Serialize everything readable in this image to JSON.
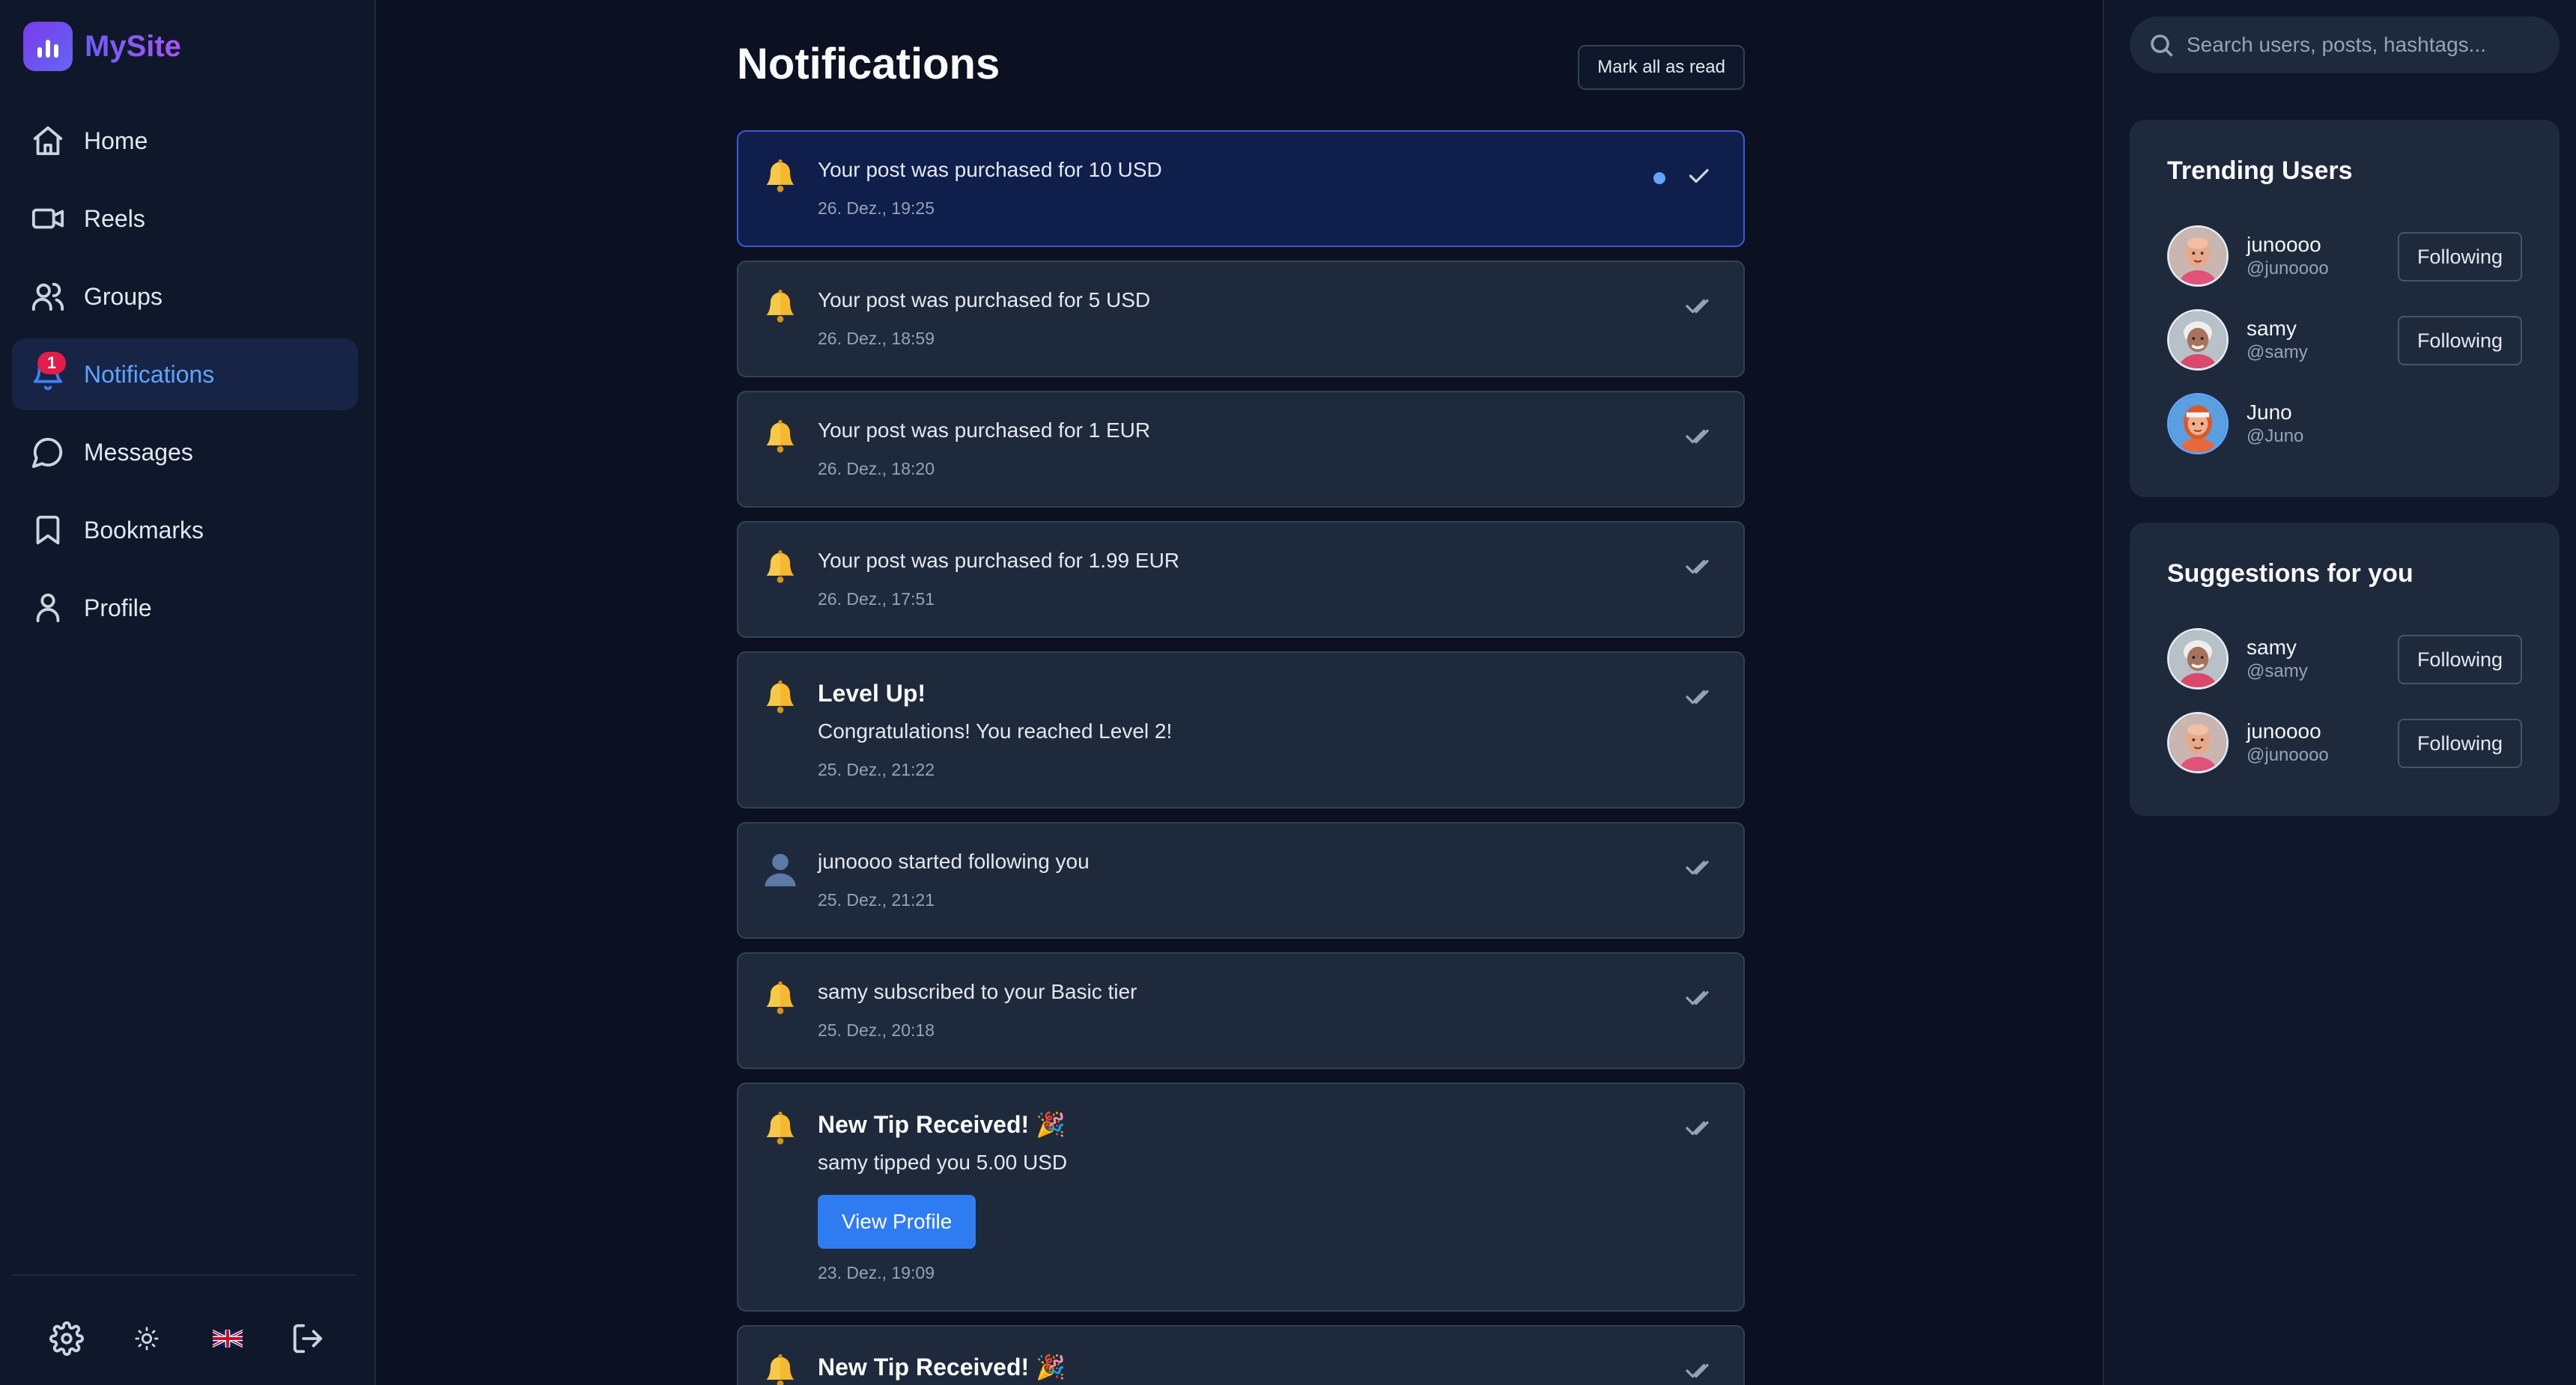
{
  "brand": {
    "name": "MySite"
  },
  "nav": {
    "items": [
      {
        "label": "Home",
        "icon": "home-icon",
        "active": false
      },
      {
        "label": "Reels",
        "icon": "video-icon",
        "active": false
      },
      {
        "label": "Groups",
        "icon": "users-icon",
        "active": false
      },
      {
        "label": "Notifications",
        "icon": "bell-icon",
        "active": true,
        "badge": "1"
      },
      {
        "label": "Messages",
        "icon": "chat-bubble-icon",
        "active": false
      },
      {
        "label": "Bookmarks",
        "icon": "bookmark-icon",
        "active": false
      },
      {
        "label": "Profile",
        "icon": "user-icon",
        "active": false
      }
    ],
    "footer": [
      "gear-icon",
      "sun-icon",
      "uk-flag-icon",
      "logout-icon"
    ]
  },
  "main": {
    "title": "Notifications",
    "mark_all_label": "Mark all as read",
    "notifications": [
      {
        "icon": "bell-emoji",
        "text": "Your post was purchased for 10 USD",
        "time": "26. Dez., 19:25",
        "unread": true
      },
      {
        "icon": "bell-emoji",
        "text": "Your post was purchased for 5 USD",
        "time": "26. Dez., 18:59",
        "unread": false
      },
      {
        "icon": "bell-emoji",
        "text": "Your post was purchased for 1 EUR",
        "time": "26. Dez., 18:20",
        "unread": false
      },
      {
        "icon": "bell-emoji",
        "text": "Your post was purchased for 1.99 EUR",
        "time": "26. Dez., 17:51",
        "unread": false
      },
      {
        "icon": "bell-emoji",
        "title": "Level Up!",
        "text": "Congratulations! You reached Level 2!",
        "time": "25. Dez., 21:22",
        "unread": false
      },
      {
        "icon": "person-emoji",
        "text": "junoooo started following you",
        "time": "25. Dez., 21:21",
        "unread": false
      },
      {
        "icon": "bell-emoji",
        "text": "samy subscribed to your Basic tier",
        "time": "25. Dez., 20:18",
        "unread": false
      },
      {
        "icon": "bell-emoji",
        "title": "New Tip Received! 🎉",
        "text": "samy tipped you 5.00 USD",
        "button": "View Profile",
        "time": "23. Dez., 19:09",
        "unread": false
      },
      {
        "icon": "bell-emoji",
        "title": "New Tip Received! 🎉",
        "unread": false
      }
    ]
  },
  "right": {
    "search_placeholder": "Search users, posts, hashtags...",
    "trending": {
      "title": "Trending Users",
      "users": [
        {
          "name": "junoooo",
          "handle": "@junoooo",
          "button": "Following",
          "avatar": "avatar-bald-man"
        },
        {
          "name": "samy",
          "handle": "@samy",
          "button": "Following",
          "avatar": "avatar-white-hair"
        },
        {
          "name": "Juno",
          "handle": "@Juno",
          "avatar": "avatar-redhead"
        }
      ]
    },
    "suggestions": {
      "title": "Suggestions for you",
      "users": [
        {
          "name": "samy",
          "handle": "@samy",
          "button": "Following",
          "avatar": "avatar-white-hair"
        },
        {
          "name": "junoooo",
          "handle": "@junoooo",
          "button": "Following",
          "avatar": "avatar-bald-man"
        }
      ]
    }
  }
}
